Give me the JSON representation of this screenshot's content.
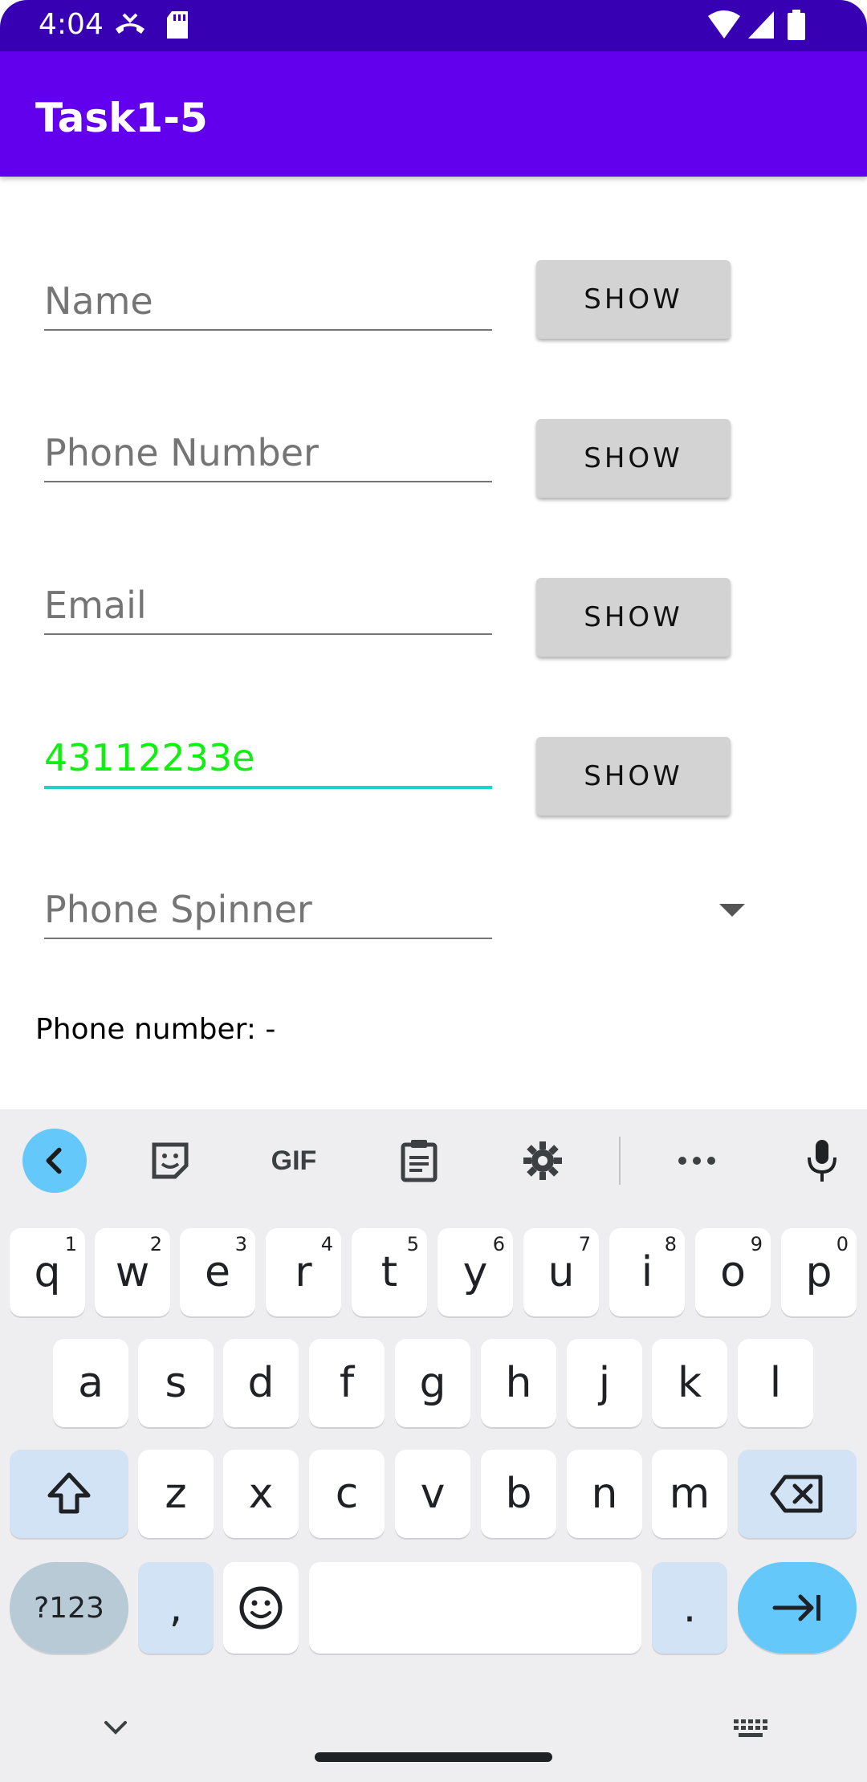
{
  "status_bar": {
    "time": "4:04",
    "icons": [
      "missed-call-icon",
      "sd-card-icon",
      "wifi-icon",
      "signal-icon",
      "battery-icon"
    ]
  },
  "app_bar": {
    "title": "Task1-5"
  },
  "form": {
    "name_field": {
      "placeholder": "Name",
      "value": ""
    },
    "phone_field": {
      "placeholder": "Phone Number",
      "value": ""
    },
    "email_field": {
      "placeholder": "Email",
      "value": ""
    },
    "id_field": {
      "placeholder": "",
      "value": "43112233e"
    },
    "spinner": {
      "placeholder": "Phone Spinner"
    },
    "show_label": "SHOW",
    "phone_number_label": "Phone number:  -"
  },
  "keyboard": {
    "toolbar_icons": [
      "back-chevron-icon",
      "sticker-icon",
      "gif-icon",
      "clipboard-icon",
      "settings-gear-icon",
      "more-dots-icon",
      "microphone-icon"
    ],
    "gif_label": "GIF",
    "row1": [
      {
        "key": "q",
        "hint": "1"
      },
      {
        "key": "w",
        "hint": "2"
      },
      {
        "key": "e",
        "hint": "3"
      },
      {
        "key": "r",
        "hint": "4"
      },
      {
        "key": "t",
        "hint": "5"
      },
      {
        "key": "y",
        "hint": "6"
      },
      {
        "key": "u",
        "hint": "7"
      },
      {
        "key": "i",
        "hint": "8"
      },
      {
        "key": "o",
        "hint": "9"
      },
      {
        "key": "p",
        "hint": "0"
      }
    ],
    "row2": [
      "a",
      "s",
      "d",
      "f",
      "g",
      "h",
      "j",
      "k",
      "l"
    ],
    "row3": [
      "z",
      "x",
      "c",
      "v",
      "b",
      "n",
      "m"
    ],
    "sym_label": "?123",
    "comma_label": ",",
    "period_label": "."
  },
  "colors": {
    "status_bar": "#3700b3",
    "app_bar": "#6200ee",
    "focused_text": "#11ee11",
    "focused_underline": "#1ad6c6",
    "button_bg": "#d3d3d3",
    "enter_key": "#64c8fa"
  }
}
